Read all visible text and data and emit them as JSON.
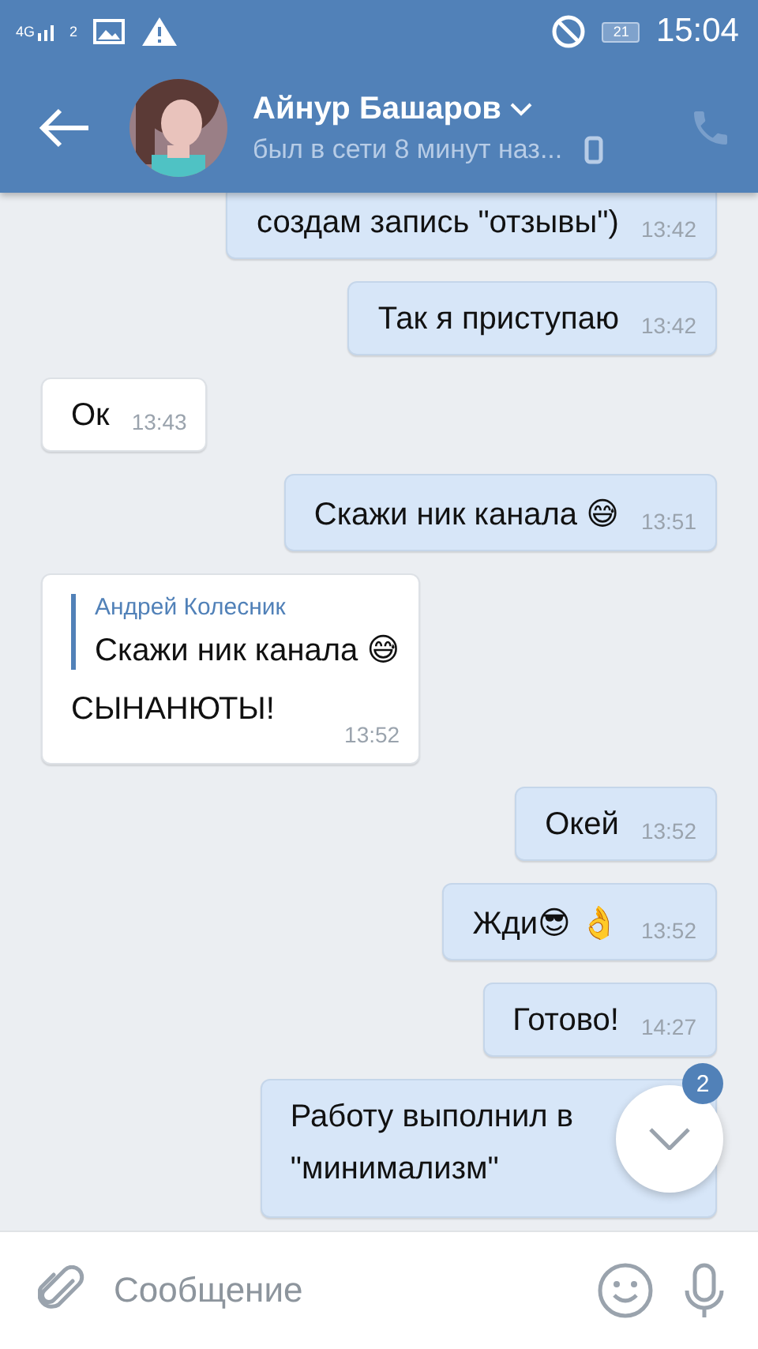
{
  "status_bar": {
    "network": "4G",
    "sim": "2",
    "time": "15:04",
    "battery": "21"
  },
  "header": {
    "name": "Айнур Башаров",
    "status": "был в сети 8 минут наз..."
  },
  "messages": [
    {
      "kind": "outgoing",
      "lines": [
        "создам запись \"отзывы\")"
      ],
      "time": "13:42"
    },
    {
      "kind": "outgoing",
      "lines": [
        "Так я приступаю"
      ],
      "time": "13:42"
    },
    {
      "kind": "incoming",
      "lines": [
        "Ок"
      ],
      "time": "13:43"
    },
    {
      "kind": "outgoing",
      "lines": [
        "Скажи ник канала 😅"
      ],
      "time": "13:51"
    },
    {
      "kind": "incoming",
      "quote": {
        "author": "Андрей Колесник",
        "text": "Скажи ник канала 😅"
      },
      "lines": [
        "СЫНАНЮТЫ!"
      ],
      "time": "13:52"
    },
    {
      "kind": "outgoing",
      "lines": [
        "Окей"
      ],
      "time": "13:52"
    },
    {
      "kind": "outgoing",
      "lines": [
        "Жди😎 👌"
      ],
      "time": "13:52"
    },
    {
      "kind": "outgoing",
      "lines": [
        "Готово!"
      ],
      "time": "14:27"
    },
    {
      "kind": "outgoing",
      "lines": [
        "Работу выполнил в",
        "\"минимализм\""
      ]
    }
  ],
  "scroll_button": {
    "badge": "2"
  },
  "composer": {
    "placeholder": "Сообщение"
  }
}
